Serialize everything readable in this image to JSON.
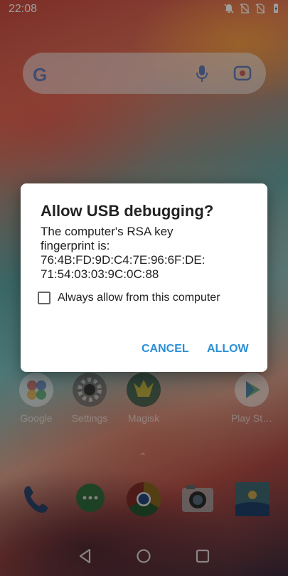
{
  "status_bar": {
    "time": "22:08",
    "icons": [
      "notifications-off-icon",
      "no-sim-icon",
      "no-sim-icon",
      "battery-charging-icon"
    ]
  },
  "search": {
    "logo": "G",
    "icons": [
      "mic-icon",
      "lens-icon"
    ]
  },
  "apps": [
    {
      "label": "Google",
      "icon": "google-folder-icon"
    },
    {
      "label": "Settings",
      "icon": "settings-gear-icon"
    },
    {
      "label": "Magisk",
      "icon": "magisk-icon"
    },
    {
      "label": "Play St…",
      "icon": "play-store-icon"
    }
  ],
  "dock": [
    "phone-icon",
    "messages-icon",
    "chrome-icon",
    "camera-icon",
    "gallery-icon"
  ],
  "navigation": [
    "back-icon",
    "home-icon",
    "recents-icon"
  ],
  "dialog": {
    "title": "Allow USB debugging?",
    "body_lines": [
      "The computer's RSA key",
      "fingerprint is:",
      "76:4B:FD:9D:C4:7E:96:6F:DE:",
      "71:54:03:03:9C:0C:88"
    ],
    "checkbox_label": "Always allow from this computer",
    "checkbox_checked": false,
    "cancel_label": "CANCEL",
    "allow_label": "ALLOW",
    "accent_color": "#2a8fd6"
  }
}
